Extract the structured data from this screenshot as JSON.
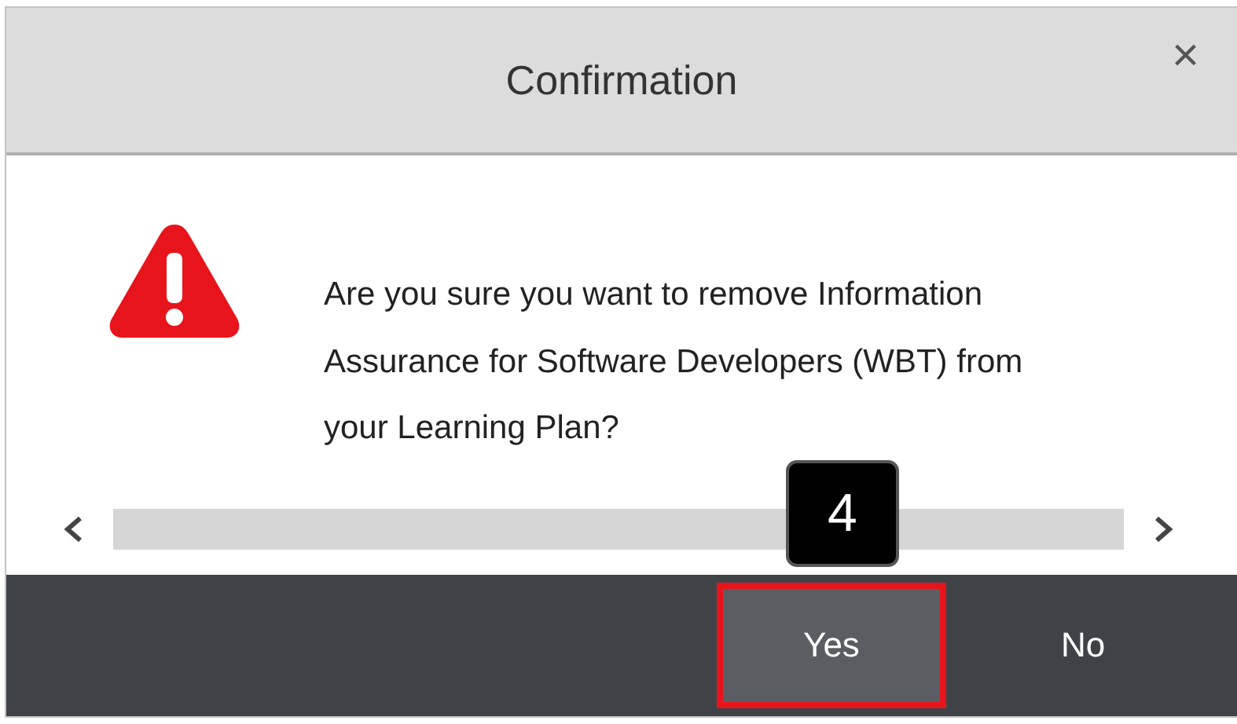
{
  "dialog": {
    "title": "Confirmation",
    "close": "×",
    "message_lines": [
      "Are you sure you want to remove Information",
      "Assurance for Software Developers (WBT) from",
      "your Learning Plan?"
    ],
    "buttons": [
      {
        "label": "Yes",
        "highlighted": true
      },
      {
        "label": "No",
        "highlighted": false
      }
    ]
  },
  "annotation": {
    "step": "4"
  }
}
